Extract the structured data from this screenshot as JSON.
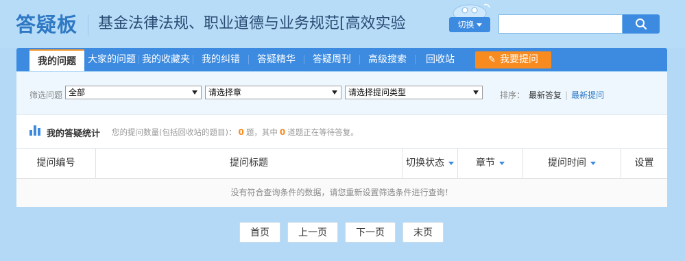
{
  "header": {
    "logo": "答疑板",
    "course_title": "基金法律法规、职业道德与业务规范[高效实验",
    "switch_label": "切换",
    "search": {
      "value": "",
      "placeholder": ""
    }
  },
  "nav": {
    "tabs": [
      {
        "label": "我的问题",
        "active": true
      },
      {
        "label": "大家的问题"
      },
      {
        "label": "我的收藏夹"
      },
      {
        "label": "我的纠错"
      },
      {
        "label": "答疑精华"
      },
      {
        "label": "答疑周刊"
      },
      {
        "label": "高级搜索"
      },
      {
        "label": "回收站"
      }
    ],
    "ask_button": "我要提问"
  },
  "filter": {
    "label": "筛选问题",
    "selects": [
      "全部",
      "请选择章",
      "请选择提问类型"
    ],
    "sort_label": "排序：",
    "sort_options": [
      "最新答复",
      "最新提问"
    ]
  },
  "stats": {
    "title": "我的答疑统计",
    "text_prefix": "您的提问数量(包括回收站的题目)：",
    "total": "0",
    "text_middle": "题，其中",
    "waiting": "0",
    "text_suffix": "道题正在等待答复。"
  },
  "table": {
    "columns": [
      "提问编号",
      "提问标题",
      "切换状态",
      "章节",
      "提问时间",
      "设置"
    ],
    "empty_message": "没有符合查询条件的数据，请您重新设置筛选条件进行查询！"
  },
  "pager": [
    "首页",
    "上一页",
    "下一页",
    "末页"
  ],
  "colors": {
    "nav_blue": "#3c8be0",
    "accent_orange": "#f78b1f",
    "logo_blue": "#2f78c4"
  }
}
